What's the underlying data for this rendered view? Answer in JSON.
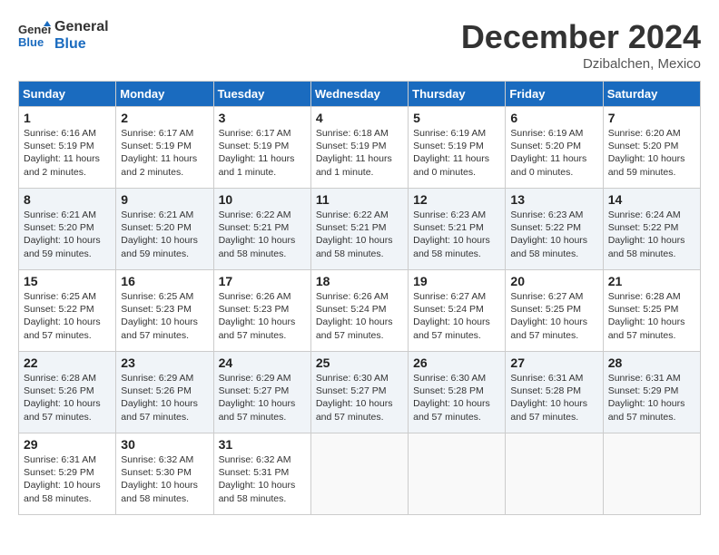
{
  "header": {
    "logo_line1": "General",
    "logo_line2": "Blue",
    "month_title": "December 2024",
    "location": "Dzibalchen, Mexico"
  },
  "days_of_week": [
    "Sunday",
    "Monday",
    "Tuesday",
    "Wednesday",
    "Thursday",
    "Friday",
    "Saturday"
  ],
  "weeks": [
    [
      {
        "day": "1",
        "text": "Sunrise: 6:16 AM\nSunset: 5:19 PM\nDaylight: 11 hours\nand 2 minutes."
      },
      {
        "day": "2",
        "text": "Sunrise: 6:17 AM\nSunset: 5:19 PM\nDaylight: 11 hours\nand 2 minutes."
      },
      {
        "day": "3",
        "text": "Sunrise: 6:17 AM\nSunset: 5:19 PM\nDaylight: 11 hours\nand 1 minute."
      },
      {
        "day": "4",
        "text": "Sunrise: 6:18 AM\nSunset: 5:19 PM\nDaylight: 11 hours\nand 1 minute."
      },
      {
        "day": "5",
        "text": "Sunrise: 6:19 AM\nSunset: 5:19 PM\nDaylight: 11 hours\nand 0 minutes."
      },
      {
        "day": "6",
        "text": "Sunrise: 6:19 AM\nSunset: 5:20 PM\nDaylight: 11 hours\nand 0 minutes."
      },
      {
        "day": "7",
        "text": "Sunrise: 6:20 AM\nSunset: 5:20 PM\nDaylight: 10 hours\nand 59 minutes."
      }
    ],
    [
      {
        "day": "8",
        "text": "Sunrise: 6:21 AM\nSunset: 5:20 PM\nDaylight: 10 hours\nand 59 minutes."
      },
      {
        "day": "9",
        "text": "Sunrise: 6:21 AM\nSunset: 5:20 PM\nDaylight: 10 hours\nand 59 minutes."
      },
      {
        "day": "10",
        "text": "Sunrise: 6:22 AM\nSunset: 5:21 PM\nDaylight: 10 hours\nand 58 minutes."
      },
      {
        "day": "11",
        "text": "Sunrise: 6:22 AM\nSunset: 5:21 PM\nDaylight: 10 hours\nand 58 minutes."
      },
      {
        "day": "12",
        "text": "Sunrise: 6:23 AM\nSunset: 5:21 PM\nDaylight: 10 hours\nand 58 minutes."
      },
      {
        "day": "13",
        "text": "Sunrise: 6:23 AM\nSunset: 5:22 PM\nDaylight: 10 hours\nand 58 minutes."
      },
      {
        "day": "14",
        "text": "Sunrise: 6:24 AM\nSunset: 5:22 PM\nDaylight: 10 hours\nand 58 minutes."
      }
    ],
    [
      {
        "day": "15",
        "text": "Sunrise: 6:25 AM\nSunset: 5:22 PM\nDaylight: 10 hours\nand 57 minutes."
      },
      {
        "day": "16",
        "text": "Sunrise: 6:25 AM\nSunset: 5:23 PM\nDaylight: 10 hours\nand 57 minutes."
      },
      {
        "day": "17",
        "text": "Sunrise: 6:26 AM\nSunset: 5:23 PM\nDaylight: 10 hours\nand 57 minutes."
      },
      {
        "day": "18",
        "text": "Sunrise: 6:26 AM\nSunset: 5:24 PM\nDaylight: 10 hours\nand 57 minutes."
      },
      {
        "day": "19",
        "text": "Sunrise: 6:27 AM\nSunset: 5:24 PM\nDaylight: 10 hours\nand 57 minutes."
      },
      {
        "day": "20",
        "text": "Sunrise: 6:27 AM\nSunset: 5:25 PM\nDaylight: 10 hours\nand 57 minutes."
      },
      {
        "day": "21",
        "text": "Sunrise: 6:28 AM\nSunset: 5:25 PM\nDaylight: 10 hours\nand 57 minutes."
      }
    ],
    [
      {
        "day": "22",
        "text": "Sunrise: 6:28 AM\nSunset: 5:26 PM\nDaylight: 10 hours\nand 57 minutes."
      },
      {
        "day": "23",
        "text": "Sunrise: 6:29 AM\nSunset: 5:26 PM\nDaylight: 10 hours\nand 57 minutes."
      },
      {
        "day": "24",
        "text": "Sunrise: 6:29 AM\nSunset: 5:27 PM\nDaylight: 10 hours\nand 57 minutes."
      },
      {
        "day": "25",
        "text": "Sunrise: 6:30 AM\nSunset: 5:27 PM\nDaylight: 10 hours\nand 57 minutes."
      },
      {
        "day": "26",
        "text": "Sunrise: 6:30 AM\nSunset: 5:28 PM\nDaylight: 10 hours\nand 57 minutes."
      },
      {
        "day": "27",
        "text": "Sunrise: 6:31 AM\nSunset: 5:28 PM\nDaylight: 10 hours\nand 57 minutes."
      },
      {
        "day": "28",
        "text": "Sunrise: 6:31 AM\nSunset: 5:29 PM\nDaylight: 10 hours\nand 57 minutes."
      }
    ],
    [
      {
        "day": "29",
        "text": "Sunrise: 6:31 AM\nSunset: 5:29 PM\nDaylight: 10 hours\nand 58 minutes."
      },
      {
        "day": "30",
        "text": "Sunrise: 6:32 AM\nSunset: 5:30 PM\nDaylight: 10 hours\nand 58 minutes."
      },
      {
        "day": "31",
        "text": "Sunrise: 6:32 AM\nSunset: 5:31 PM\nDaylight: 10 hours\nand 58 minutes."
      },
      {
        "day": "",
        "text": ""
      },
      {
        "day": "",
        "text": ""
      },
      {
        "day": "",
        "text": ""
      },
      {
        "day": "",
        "text": ""
      }
    ]
  ]
}
